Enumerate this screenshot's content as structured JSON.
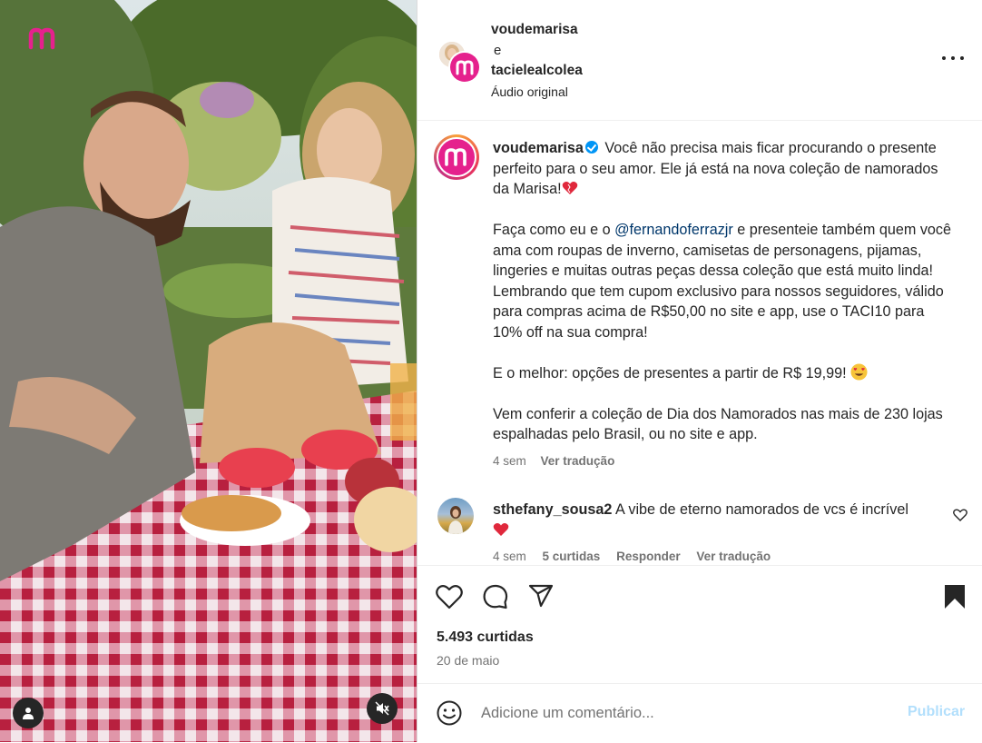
{
  "header": {
    "user1": "voudemarisa",
    "connector": "e",
    "user2": "tacielealcolea",
    "audio": "Áudio original"
  },
  "caption": {
    "username": "voudemarisa",
    "text_1": " Você não precisa mais ficar procurando o presente perfeito para o seu amor. Ele já está na nova coleção de namorados da Marisa!",
    "text_2_pre": "\n\nFaça como eu e o ",
    "mention": "@fernandoferrazjr",
    "text_2_post": " e presenteie também quem você ama com roupas de inverno, camisetas de personagens, pijamas, lingeries e muitas outras peças dessa coleção que está muito linda!  Lembrando que tem cupom exclusivo para nossos seguidores, válido para compras acima de R$50,00 no site e app, use o TACI10 para 10% off na sua compra!\n\nE o melhor: opções de presentes a partir de R$ 19,99! ",
    "text_3": "\n\nVem conferir a coleção de Dia dos Namorados nas mais de 230 lojas espalhadas pelo Brasil, ou no site e app.",
    "time": "4 sem",
    "translate": "Ver tradução"
  },
  "comment": {
    "username": "sthefany_sousa2",
    "text": " A vibe de eterno namorados de vcs é incrível",
    "time": "4 sem",
    "likes": "5 curtidas",
    "reply": "Responder",
    "translate": "Ver tradução"
  },
  "actions": {
    "likes": "5.493 curtidas",
    "date": "20 de maio"
  },
  "add_comment": {
    "placeholder": "Adicione um comentário...",
    "publish": "Publicar"
  },
  "icons": {
    "brand": "marisa-logo-icon",
    "more": "more-options-icon",
    "verified": "verified-badge-icon",
    "like": "heart-outline-icon",
    "comment": "comment-bubble-icon",
    "share": "paper-plane-icon",
    "save": "bookmark-filled-icon",
    "emoji": "smiley-icon",
    "user_tag": "user-tag-icon",
    "mute": "speaker-muted-icon"
  },
  "colors": {
    "brand": "#e5218d",
    "verified": "#0095f6",
    "mention": "#00376b",
    "publish_disabled": "#b2dffc"
  }
}
